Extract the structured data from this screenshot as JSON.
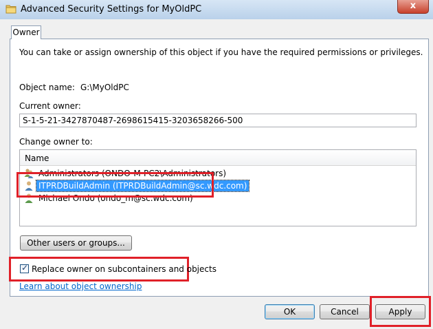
{
  "window": {
    "title": "Advanced Security Settings for MyOldPC",
    "close_glyph": "x"
  },
  "tabs": [
    {
      "label": "Owner"
    }
  ],
  "owner_tab": {
    "intro": "You can take or assign ownership of this object if you have the required permissions or privileges.",
    "object_name_label": "Object name:",
    "object_name_value": "G:\\MyOldPC",
    "current_owner_label": "Current owner:",
    "current_owner_value": "S-1-5-21-3427870487-2698615415-3203658266-500",
    "change_owner_label": "Change owner to:",
    "list": {
      "column_header": "Name",
      "rows": [
        {
          "name": "Administrators (ONDO-M-PC2\\Administrators)",
          "icon": "group-users-icon",
          "selected": false
        },
        {
          "name": "ITPRDBuildAdmin (ITPRDBuildAdmin@sc.wdc.com)",
          "icon": "user-icon",
          "selected": true
        },
        {
          "name": "Michael Ondo (ondo_m@sc.wdc.com)",
          "icon": "user-icon",
          "selected": false
        }
      ]
    },
    "other_users_button": "Other users or groups...",
    "replace_owner_checkbox": {
      "label": "Replace owner on subcontainers and objects",
      "checked": true
    },
    "learn_link": "Learn about object ownership"
  },
  "footer_buttons": {
    "ok": "OK",
    "cancel": "Cancel",
    "apply": "Apply"
  },
  "colors": {
    "highlight_border": "#e02028",
    "selection": "#3399ff",
    "link": "#0066cc"
  }
}
